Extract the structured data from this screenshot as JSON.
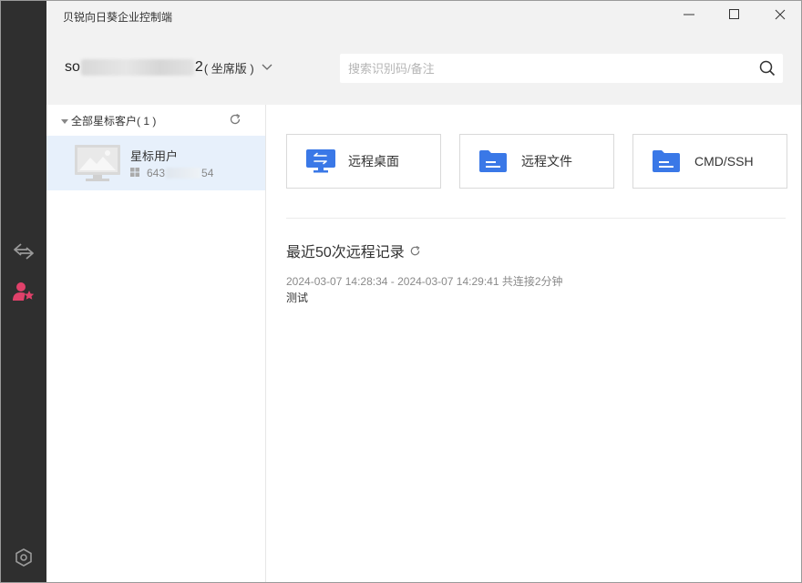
{
  "window": {
    "title": "贝锐向日葵企业控制端"
  },
  "account": {
    "name_prefix": "so",
    "name_suffix": "2",
    "edition": "( 坐席版 )"
  },
  "search": {
    "placeholder": "搜索识别码/备注",
    "value": ""
  },
  "sidebar": {
    "items": [
      {
        "icon": "remote-connect-icon"
      },
      {
        "icon": "star-user-icon",
        "active": true
      },
      {
        "icon": "settings-icon"
      }
    ]
  },
  "clients": {
    "group_label": "全部星标客户( 1 )",
    "items": [
      {
        "name": "星标用户",
        "id_prefix": "643",
        "id_suffix": "54",
        "os": "windows-icon"
      }
    ]
  },
  "actions": [
    {
      "label": "远程桌面",
      "icon": "remote-desktop-icon"
    },
    {
      "label": "远程文件",
      "icon": "folder-icon"
    },
    {
      "label": "CMD/SSH",
      "icon": "folder-icon"
    }
  ],
  "history": {
    "title": "最近50次远程记录",
    "records": [
      {
        "time": "2024-03-07 14:28:34 - 2024-03-07 14:29:41 共连接2分钟",
        "note": "测试"
      }
    ]
  },
  "colors": {
    "accent": "#3a78e7",
    "rail": "#2f2f2f",
    "active_icon": "#e0416a",
    "selected_row": "#e7f0fb"
  }
}
